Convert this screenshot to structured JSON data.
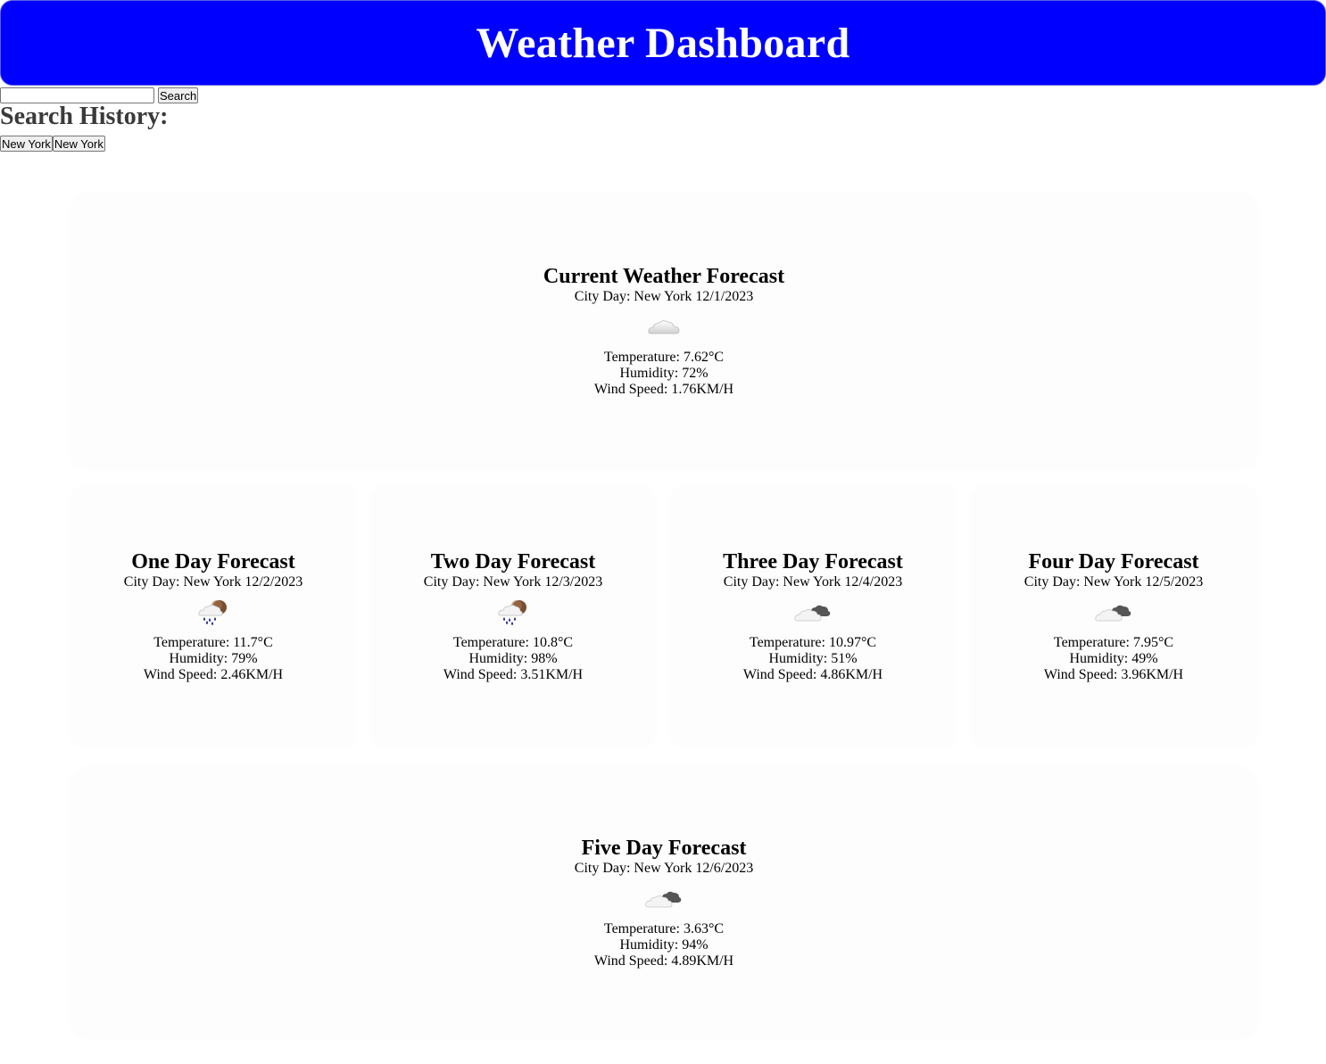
{
  "header": {
    "title": "Weather Dashboard"
  },
  "search": {
    "placeholder": "",
    "value": "",
    "button_label": "Search"
  },
  "history": {
    "title": "Search History:",
    "items": [
      "New York",
      "New York"
    ]
  },
  "current": {
    "title": "Current Weather Forecast",
    "city_day": "City Day: New York 12/1/2023",
    "icon": "cloud-icon",
    "temperature": "Temperature: 7.62°C",
    "humidity": "Humidity: 72%",
    "wind": "Wind Speed: 1.76KM/H"
  },
  "forecast": [
    {
      "title": "One Day Forecast",
      "city_day": "City Day: New York 12/2/2023",
      "icon": "rain-night-icon",
      "temperature": "Temperature: 11.7°C",
      "humidity": "Humidity: 79%",
      "wind": "Wind Speed: 2.46KM/H"
    },
    {
      "title": "Two Day Forecast",
      "city_day": "City Day: New York 12/3/2023",
      "icon": "rain-night-icon",
      "temperature": "Temperature: 10.8°C",
      "humidity": "Humidity: 98%",
      "wind": "Wind Speed: 3.51KM/H"
    },
    {
      "title": "Three Day Forecast",
      "city_day": "City Day: New York 12/4/2023",
      "icon": "broken-clouds-icon",
      "temperature": "Temperature: 10.97°C",
      "humidity": "Humidity: 51%",
      "wind": "Wind Speed: 4.86KM/H"
    },
    {
      "title": "Four Day Forecast",
      "city_day": "City Day: New York 12/5/2023",
      "icon": "broken-clouds-icon",
      "temperature": "Temperature: 7.95°C",
      "humidity": "Humidity: 49%",
      "wind": "Wind Speed: 3.96KM/H"
    },
    {
      "title": "Five Day Forecast",
      "city_day": "City Day: New York 12/6/2023",
      "icon": "broken-clouds-icon",
      "temperature": "Temperature: 3.63°C",
      "humidity": "Humidity: 94%",
      "wind": "Wind Speed: 4.89KM/H"
    }
  ],
  "colors": {
    "header_bg": "#0000ff",
    "header_text": "#ffffff",
    "card_bg": "#fdfdfd"
  }
}
